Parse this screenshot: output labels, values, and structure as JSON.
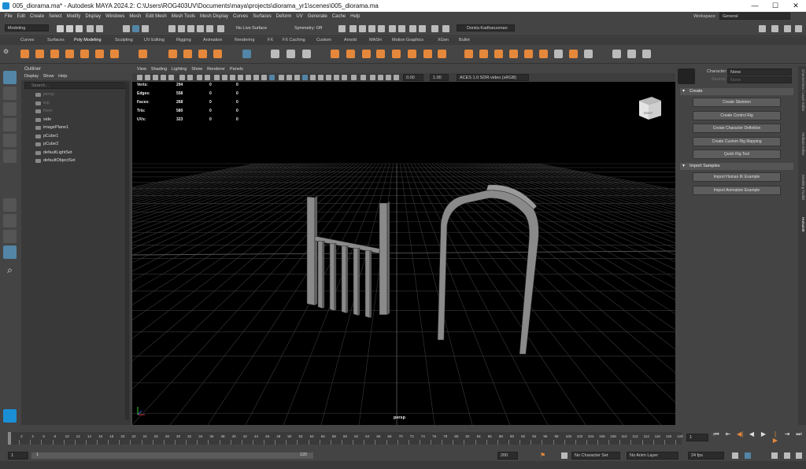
{
  "window": {
    "title": "005_diorama.ma* - Autodesk MAYA 2024.2: C:\\Users\\ROG403UV\\Documents\\maya\\projects\\diorama_yr1\\scenes\\005_diorama.ma"
  },
  "menubar": {
    "items": [
      "File",
      "Edit",
      "Create",
      "Select",
      "Modify",
      "Display",
      "Windows",
      "Mesh",
      "Edit Mesh",
      "Mesh Tools",
      "Mesh Display",
      "Curves",
      "Surfaces",
      "Deform",
      "UV",
      "Generate",
      "Cache",
      "Help"
    ],
    "workspace_label": "Workspace:",
    "workspace_value": "General"
  },
  "statusline": {
    "mode": "Modeling",
    "live_surface": "No Live Surface",
    "symmetry": "Symmetry: Off",
    "user": "Donita Kadharusman"
  },
  "shelf": {
    "tabs": [
      "Curves",
      "Surfaces",
      "Poly Modeling",
      "Sculpting",
      "UV Editing",
      "Rigging",
      "Animation",
      "Rendering",
      "FX",
      "FX Caching",
      "Custom",
      "Arnold",
      "MASH",
      "Motion Graphics",
      "XGen",
      "Bullet"
    ],
    "active_tab": "Poly Modeling"
  },
  "outliner": {
    "title": "Outliner",
    "menus": [
      "Display",
      "Show",
      "Help"
    ],
    "search_placeholder": "Search...",
    "items": [
      {
        "name": "persp",
        "dim": true
      },
      {
        "name": "top",
        "dim": true
      },
      {
        "name": "front",
        "dim": true
      },
      {
        "name": "side",
        "dim": false
      },
      {
        "name": "imagePlane1",
        "dim": false
      },
      {
        "name": "pCube1",
        "dim": false
      },
      {
        "name": "pCube2",
        "dim": false
      },
      {
        "name": "defaultLightSet",
        "dim": false
      },
      {
        "name": "defaultObjectSet",
        "dim": false
      }
    ]
  },
  "viewport": {
    "menus": [
      "View",
      "Shading",
      "Lighting",
      "Show",
      "Renderer",
      "Panels"
    ],
    "exposure": "0.00",
    "gamma": "1.00",
    "colorspace": "ACES 1.0 SDR-video (sRGB)",
    "hud": [
      {
        "label": "Verts:",
        "v1": "294",
        "v2": "0",
        "v3": "0"
      },
      {
        "label": "Edges:",
        "v1": "558",
        "v2": "0",
        "v3": "0"
      },
      {
        "label": "Faces:",
        "v1": "268",
        "v2": "0",
        "v3": "0"
      },
      {
        "label": "Tris:",
        "v1": "580",
        "v2": "0",
        "v3": "0"
      },
      {
        "label": "UVs:",
        "v1": "323",
        "v2": "0",
        "v3": "0"
      }
    ],
    "camera_label": "persp",
    "viewcube_face": "RIGHT"
  },
  "humanik": {
    "character_label": "Character:",
    "character_value": "None",
    "source_label": "Source:",
    "source_value": "None",
    "create_section": "Create",
    "create_buttons": [
      "Create Skeleton",
      "Create Control Rig",
      "Create Character Definition",
      "Create Custom Rig Mapping",
      "Quick Rig Tool"
    ],
    "import_section": "Import Samples",
    "import_buttons": [
      "Import Human IK Example",
      "Import Animation Example"
    ],
    "side_tabs": [
      "Channel Box / Layer Editor",
      "Attribute Editor",
      "Modeling Toolkit",
      "HumanIK"
    ]
  },
  "timeline": {
    "ticks": [
      "1",
      "2",
      "4",
      "6",
      "8",
      "10",
      "12",
      "14",
      "16",
      "18",
      "20",
      "22",
      "24",
      "26",
      "28",
      "30",
      "32",
      "34",
      "36",
      "38",
      "40",
      "42",
      "44",
      "46",
      "48",
      "50",
      "52",
      "54",
      "56",
      "58",
      "60",
      "62",
      "64",
      "66",
      "68",
      "70",
      "72",
      "74",
      "76",
      "78",
      "80",
      "82",
      "84",
      "86",
      "88",
      "90",
      "92",
      "94",
      "96",
      "98",
      "100",
      "102",
      "104",
      "106",
      "108",
      "110",
      "112",
      "114",
      "116",
      "118",
      "120"
    ],
    "current_frame": "1",
    "range_start": "1",
    "range_inner_start": "1",
    "range_inner_end": "120",
    "range_end": "200",
    "character_set": "No Character Set",
    "anim_layer": "No Anim Layer",
    "fps": "24 fps"
  },
  "colors": {
    "bg": "#444444",
    "viewport": "#000000",
    "accent": "#5285a6",
    "shelf_orange": "#e5883b"
  }
}
